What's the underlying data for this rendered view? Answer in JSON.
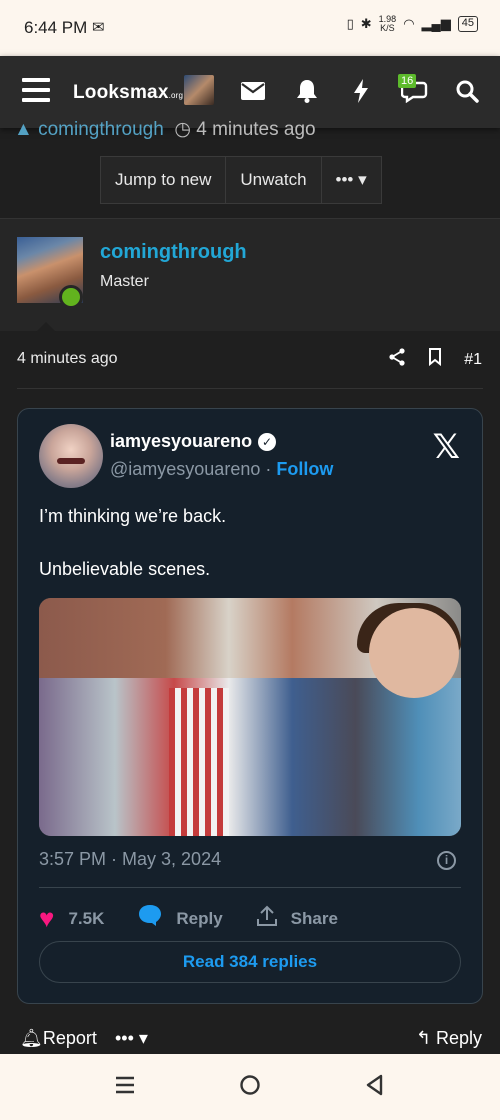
{
  "status_bar": {
    "time": "6:44 PM",
    "speed_top": "1.98",
    "speed_bottom": "K/S",
    "battery": "45"
  },
  "nav": {
    "logo": "Looksmax",
    "logo_suffix": ".org",
    "notif_badge": "16"
  },
  "prev_post": {
    "author": "comingthrough",
    "time": "4 minutes ago"
  },
  "thread_buttons": {
    "jump": "Jump to new",
    "unwatch": "Unwatch",
    "more": "••• ▾"
  },
  "post": {
    "author": "comingthrough",
    "role": "Master",
    "time": "4 minutes ago",
    "number": "#1"
  },
  "tweet": {
    "name": "iamyesyouareno",
    "handle": "@iamyesyouareno",
    "dot": "·",
    "follow": "Follow",
    "line1": "I’m thinking we’re back.",
    "line2": "Unbelievable scenes.",
    "date": "3:57 PM · May 3, 2024",
    "likes": "7.5K",
    "reply": "Reply",
    "share": "Share",
    "read_replies": "Read 384 replies"
  },
  "post_footer": {
    "report": "Report",
    "more": "••• ▾",
    "reply": "Reply"
  },
  "colors": {
    "accent": "#22a7d6",
    "twitter_blue": "#1d9bf0",
    "heart": "#f91880",
    "online": "#62b31e"
  }
}
